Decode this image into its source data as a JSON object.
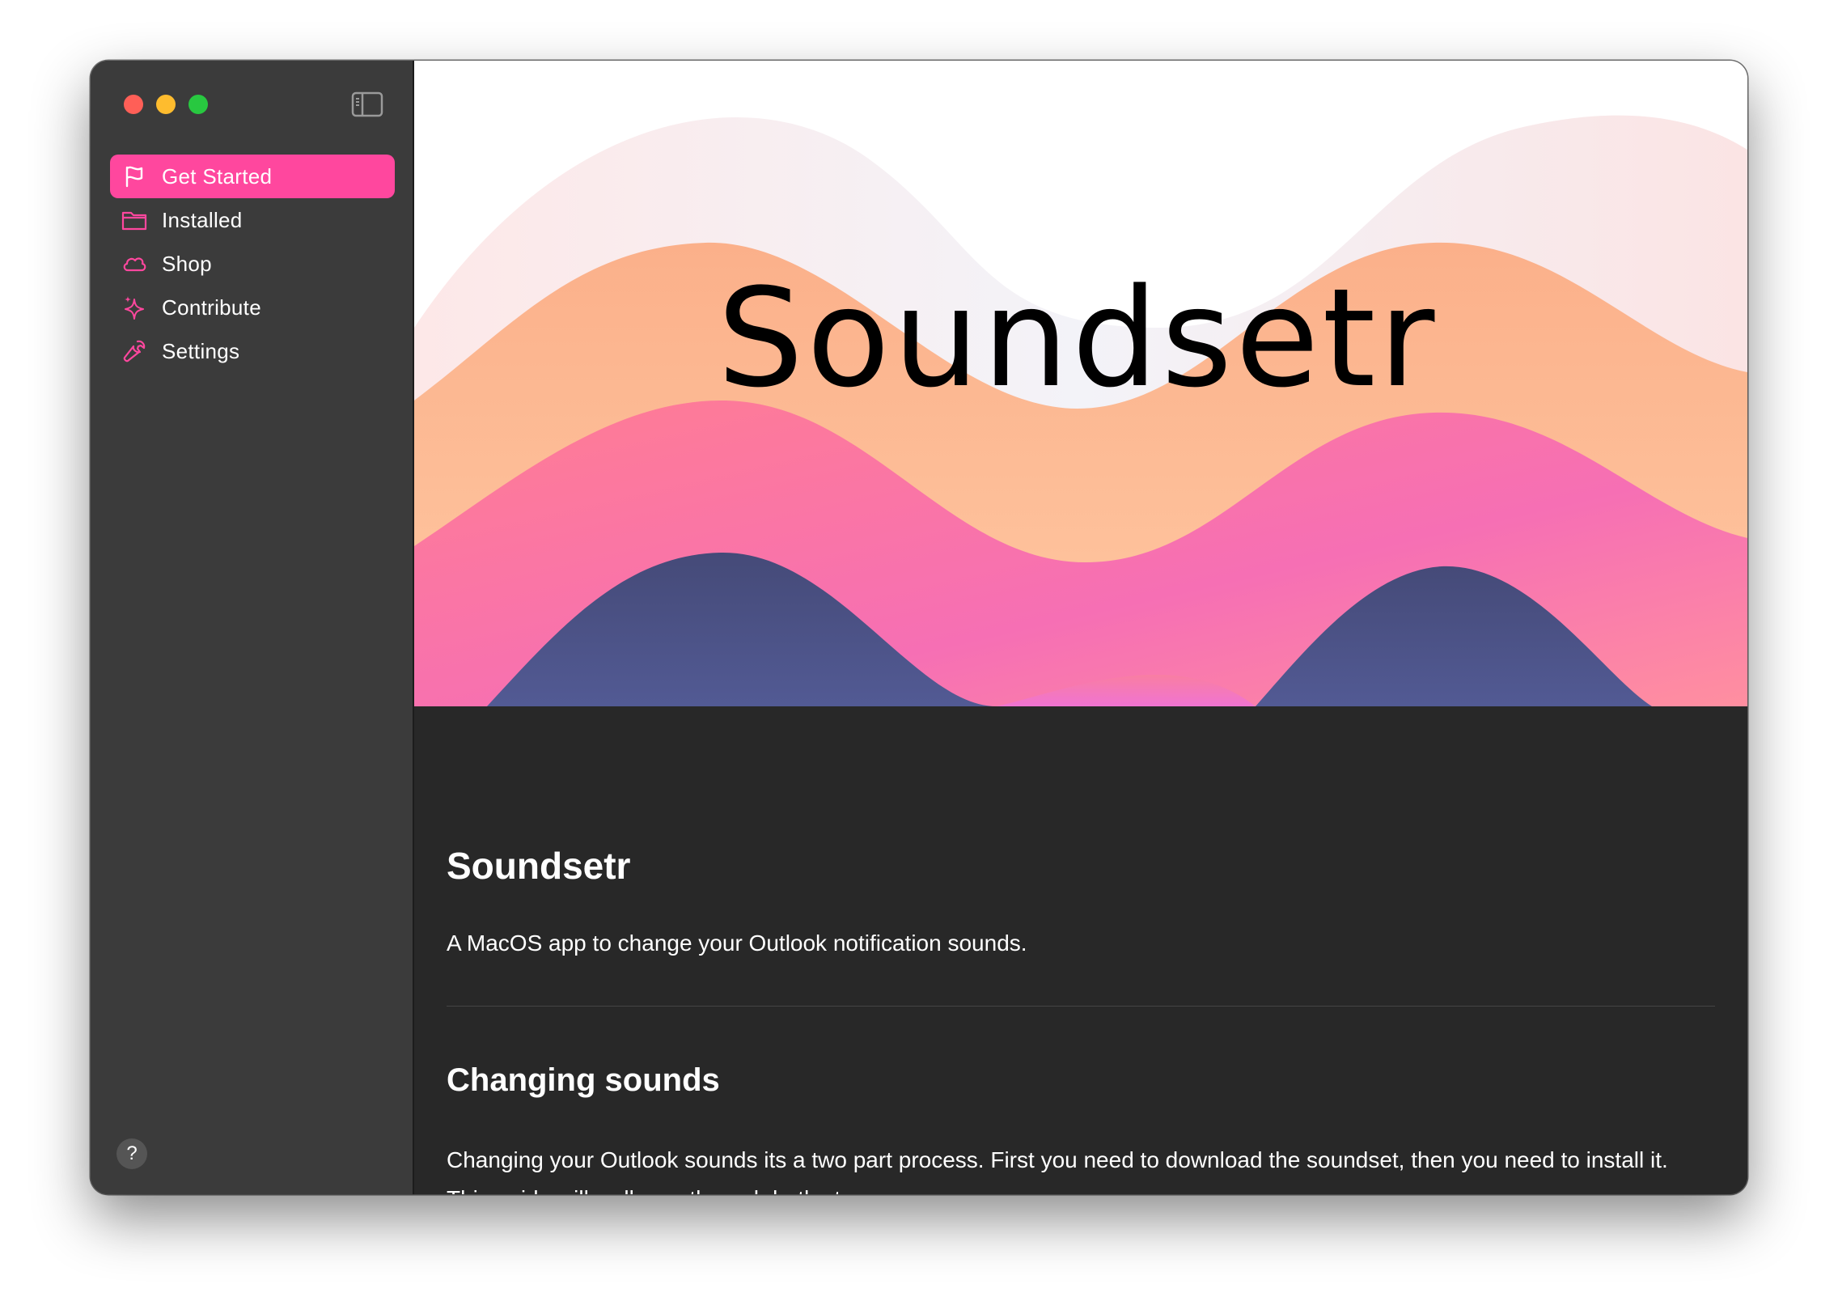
{
  "window": {
    "traffic_lights": [
      "close",
      "minimize",
      "zoom"
    ]
  },
  "sidebar": {
    "toggle_icon": "sidebar-toggle-icon",
    "accent_color": "#ff479e",
    "items": [
      {
        "label": "Get Started",
        "icon": "flag-icon",
        "active": true
      },
      {
        "label": "Installed",
        "icon": "folder-icon",
        "active": false
      },
      {
        "label": "Shop",
        "icon": "cloud-icon",
        "active": false
      },
      {
        "label": "Contribute",
        "icon": "sparkles-icon",
        "active": false
      },
      {
        "label": "Settings",
        "icon": "wrench-icon",
        "active": false
      }
    ],
    "help_label": "?"
  },
  "hero": {
    "title": "Soundsetr"
  },
  "main": {
    "heading": "Soundsetr",
    "intro": "A MacOS app to change your Outlook notification sounds.",
    "section_heading": "Changing sounds",
    "section_text": "Changing your Outlook sounds its a two part process. First you need to download the soundset, then you need to install it. This guide will walk you through both steps."
  }
}
